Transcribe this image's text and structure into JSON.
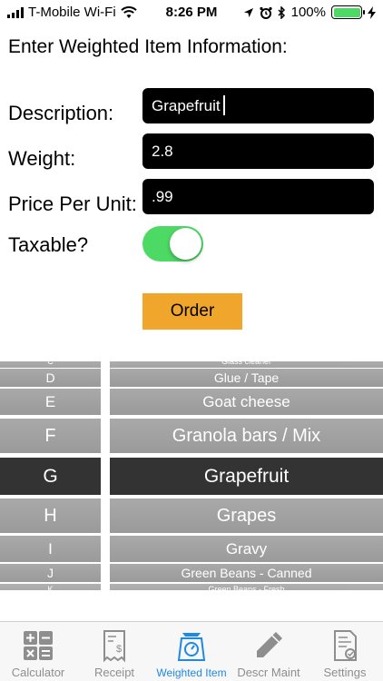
{
  "status_bar": {
    "carrier": "T-Mobile Wi-Fi",
    "time": "8:26 PM",
    "battery": "100%",
    "battery_color": "#4cd964"
  },
  "form": {
    "heading": "Enter Weighted Item Information:",
    "description_label": "Description:",
    "description_value": "Grapefruit",
    "weight_label": "Weight:",
    "weight_value": "2.8",
    "price_label": "Price Per Unit:",
    "price_value": ".99",
    "taxable_label": "Taxable?",
    "taxable_on": true,
    "order_label": "Order",
    "order_color": "#f0a62a"
  },
  "letter_picker": {
    "items": [
      "C",
      "D",
      "E",
      "F",
      "G",
      "H",
      "I",
      "J",
      "K"
    ],
    "selected": "G"
  },
  "item_picker": {
    "items": [
      "Glass cleaner",
      "Glue / Tape",
      "Goat cheese",
      "Granola bars / Mix",
      "Grapefruit",
      "Grapes",
      "Gravy",
      "Green Beans - Canned",
      "Green Beans - Fresh"
    ],
    "selected": "Grapefruit"
  },
  "tab_bar": {
    "tabs": [
      {
        "label": "Calculator",
        "icon": "calculator-icon"
      },
      {
        "label": "Receipt",
        "icon": "receipt-icon"
      },
      {
        "label": "Weighted Item",
        "icon": "scale-icon",
        "active": true
      },
      {
        "label": "Descr Maint",
        "icon": "pencil-icon"
      },
      {
        "label": "Settings",
        "icon": "settings-document-icon"
      }
    ],
    "active_color": "#1e88e5"
  }
}
